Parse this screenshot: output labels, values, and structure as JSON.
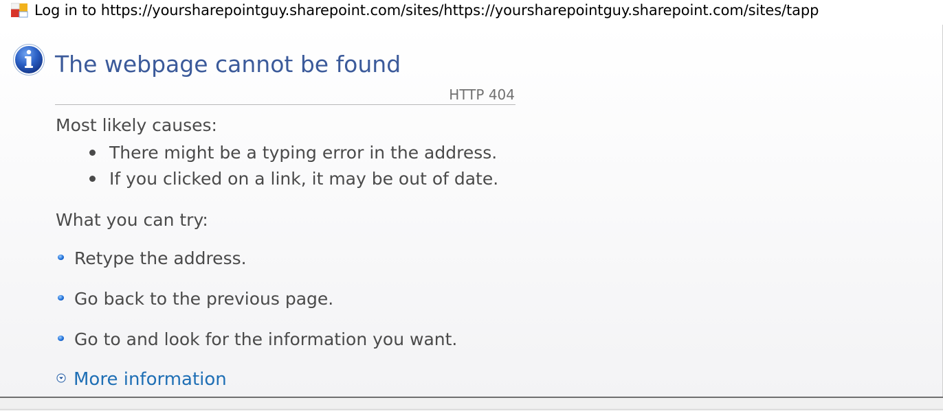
{
  "window": {
    "title": "Log in to https://yoursharepointguy.sharepoint.com/sites/https://yoursharepointguy.sharepoint.com/sites/tapp",
    "icon": "office-app-icon"
  },
  "error": {
    "icon": "info-icon",
    "heading": "The webpage cannot be found",
    "code": "HTTP 404"
  },
  "causes": {
    "label": "Most likely causes:",
    "items": [
      "There might be a typing error in the address.",
      "If you clicked on a link, it may be out of date."
    ]
  },
  "try": {
    "label": "What you can try:",
    "items": [
      "Retype the address.",
      "Go back to the previous page.",
      "Go to  and look for the information you want."
    ]
  },
  "more_info": {
    "label": "More information",
    "icon": "chevron-down-circle-icon"
  },
  "colors": {
    "heading": "#3b5a9a",
    "link": "#1f6fb5",
    "body_text": "#4a4a4a"
  }
}
